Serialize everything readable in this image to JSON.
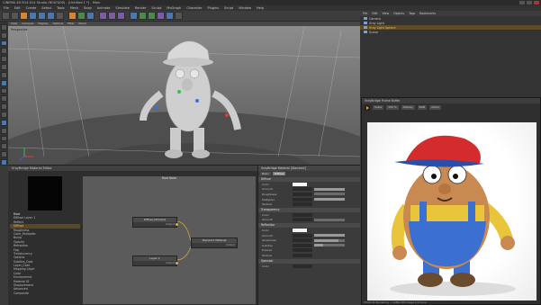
{
  "app": {
    "title": "CINEMA 4D R14.014 Studio (RC67400) - [Untitled 1 *] - Main",
    "window_controls": [
      "minimize",
      "maximize",
      "close"
    ]
  },
  "menubar": [
    "File",
    "Edit",
    "Create",
    "Select",
    "Tools",
    "Mesh",
    "Snap",
    "Animate",
    "Simulate",
    "Render",
    "Sculpt",
    "MoGraph",
    "Character",
    "Plugins",
    "Script",
    "Window",
    "Help"
  ],
  "toolbar": {
    "icons": [
      "undo-icon",
      "redo-icon",
      "select-icon",
      "move-icon",
      "scale-icon",
      "rotate-icon",
      "recent-icon",
      "x-axis-icon",
      "y-axis-icon",
      "z-axis-icon",
      "world-icon",
      "render-view-icon",
      "render-picture-viewer-icon",
      "render-settings-icon",
      "cube-icon",
      "pen-icon",
      "subdivision-icon",
      "array-icon",
      "deformer-icon",
      "floor-icon",
      "camera-icon",
      "light-icon"
    ]
  },
  "viewport": {
    "menu": [
      "View",
      "Cameras",
      "Display",
      "Options",
      "Filter",
      "Panel"
    ],
    "label": "Perspective"
  },
  "object_manager": {
    "menu": [
      "File",
      "Edit",
      "View",
      "Objects",
      "Tags",
      "Bookmarks"
    ],
    "objects": [
      {
        "name": "Camera",
        "selected": false
      },
      {
        "name": "Vray Light",
        "selected": false
      },
      {
        "name": "Vray Light Sphere",
        "selected": true
      },
      {
        "name": "Scene",
        "selected": false
      }
    ]
  },
  "node_editor": {
    "title": "VrayBridge Material Editor",
    "graph_title": "Root Node",
    "tree": [
      {
        "label": "Root",
        "header": true
      },
      {
        "label": "Diffuse Layer 1",
        "selected": false
      },
      {
        "label": "Reflect",
        "selected": false
      },
      {
        "label": "Diffuse",
        "selected": true
      },
      {
        "label": "Roughness",
        "selected": false
      },
      {
        "label": "Color_Multiplier",
        "selected": false
      },
      {
        "label": "Bump",
        "selected": false
      },
      {
        "label": "Opacity",
        "selected": false
      },
      {
        "label": "Refraction",
        "selected": false
      },
      {
        "label": "Fog",
        "selected": false
      },
      {
        "label": "Translucency",
        "selected": false
      },
      {
        "label": "Options",
        "selected": false
      },
      {
        "label": "Subdivs_Coat",
        "selected": false
      },
      {
        "label": "Layer_Coat",
        "selected": false
      },
      {
        "label": "Mapping Layer",
        "selected": false
      },
      {
        "label": "Color",
        "selected": false
      },
      {
        "label": "Environment",
        "selected": false
      },
      {
        "label": "Material ID",
        "selected": false
      },
      {
        "label": "Displacement",
        "selected": false
      },
      {
        "label": "Advanced",
        "selected": false
      },
      {
        "label": "Composite",
        "selected": false
      }
    ],
    "nodes": [
      {
        "title": "Diffuse [Shader]",
        "output": "Output"
      },
      {
        "title": "Layer 1",
        "output": "Output"
      },
      {
        "title": "Standard Material",
        "output": "Output"
      }
    ]
  },
  "attributes": {
    "title": "VrayBridge Material [Standard]",
    "tabs": [
      "Basic",
      "Diffuse"
    ],
    "sections": [
      {
        "name": "Diffuse",
        "rows": [
          {
            "label": "Color",
            "kind": "swatch"
          },
          {
            "label": "Amount",
            "kind": "slider",
            "level": 1.0
          },
          {
            "label": "Roughness",
            "kind": "slider",
            "level": 0.0
          },
          {
            "label": "Multiplier",
            "kind": "slider",
            "level": 1.0
          },
          {
            "label": "Texture",
            "kind": "field"
          }
        ]
      },
      {
        "name": "Transparency",
        "rows": [
          {
            "label": "Color",
            "kind": "field"
          },
          {
            "label": "Amount",
            "kind": "slider",
            "level": 0.0
          }
        ]
      },
      {
        "name": "Reflection",
        "rows": [
          {
            "label": "Color",
            "kind": "swatch"
          },
          {
            "label": "Amount",
            "kind": "slider",
            "level": 1.0
          },
          {
            "label": "Glossiness",
            "kind": "slider",
            "level": 0.8
          },
          {
            "label": "Subdivs",
            "kind": "slider",
            "level": 0.3
          },
          {
            "label": "Fresnel",
            "kind": "field"
          },
          {
            "label": "Texture",
            "kind": "field"
          }
        ]
      },
      {
        "name": "Specular",
        "rows": [
          {
            "label": "Color",
            "kind": "field"
          }
        ]
      }
    ]
  },
  "render_window": {
    "title": "VrayBridge Frame Buffer",
    "tools": [
      "play",
      "Scale",
      "100 %",
      "Display",
      "RGB",
      "Alpha"
    ],
    "status": "00:00:01 Rendering ... 1280x720 Image 1/1 Done"
  },
  "colors": {
    "accent": "#d8862d",
    "selection": "#f0c060",
    "node_port": "#d4b04a"
  }
}
